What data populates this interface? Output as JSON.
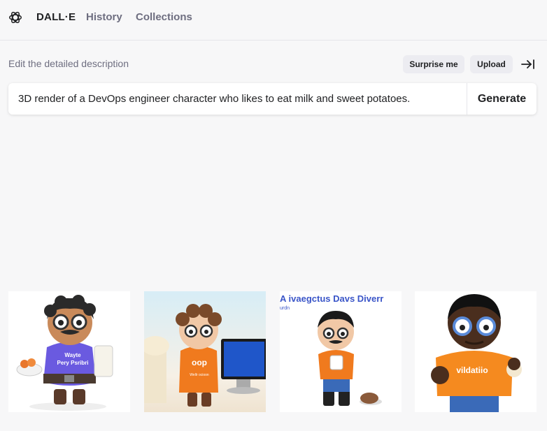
{
  "nav": {
    "brand": "DALL·E",
    "history": "History",
    "collections": "Collections"
  },
  "editor": {
    "label": "Edit the detailed description",
    "surprise": "Surprise me",
    "upload": "Upload",
    "prompt": "3D render of a DevOps engineer character who likes to eat milk and sweet potatoes.",
    "generate": "Generate"
  },
  "results": [
    {
      "shirt": "Wayte\nPery Psribri"
    },
    {
      "shirt": "oop",
      "shirt_sub": "Wellr ocioon"
    },
    {
      "headline": "A ivaegctus Davs Diverr",
      "subline": "urdn"
    },
    {
      "shirt": "vildatiio"
    }
  ]
}
